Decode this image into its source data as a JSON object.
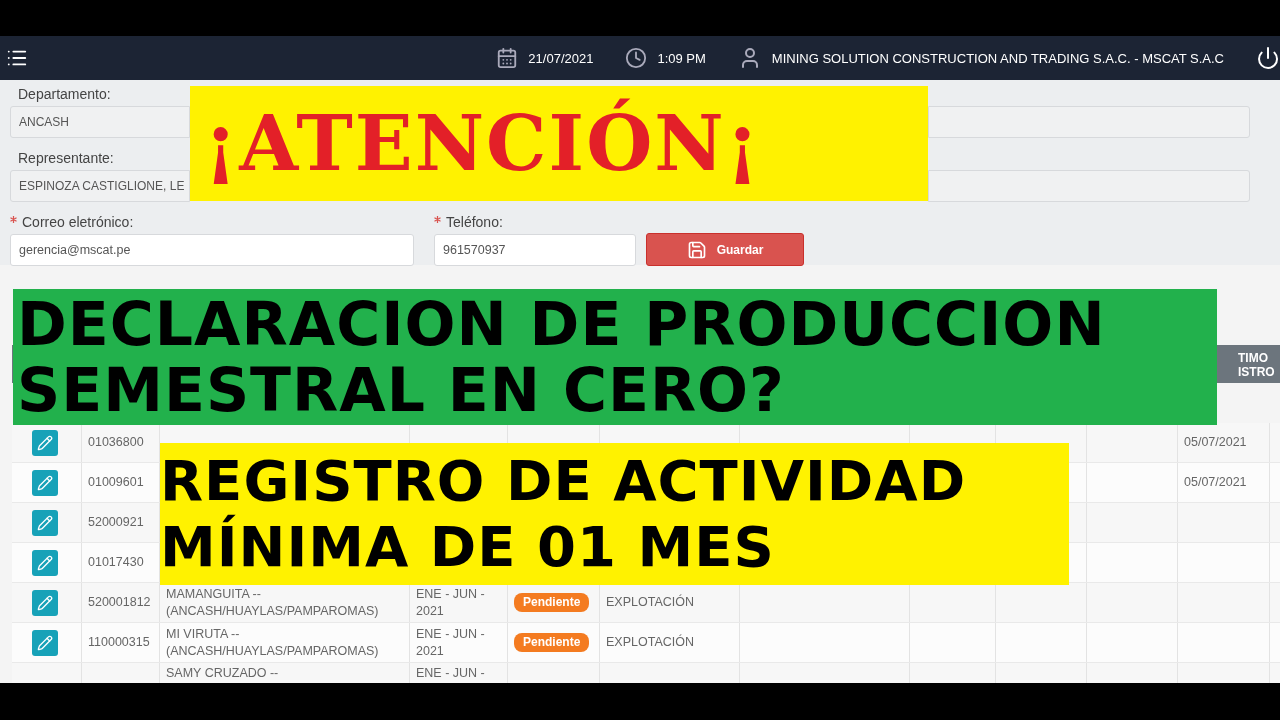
{
  "topbar": {
    "date": "21/07/2021",
    "time": "1:09 PM",
    "company": "MINING SOLUTION CONSTRUCTION AND TRADING S.A.C. - MSCAT S.A.C"
  },
  "form": {
    "wide_fields": [
      {
        "label": "Departamento:",
        "value": "ANCASH"
      },
      {
        "label": "Representante:",
        "value": "ESPINOZA CASTIGLIONE, LE"
      }
    ],
    "fields": [
      {
        "label": "Correo eletrónico:",
        "required": true,
        "value": "gerencia@mscat.pe"
      },
      {
        "label": "Teléfono:",
        "required": true,
        "value": "961570937"
      }
    ],
    "button": "Guardar"
  },
  "table": {
    "last_header": "TIMO ISTRO",
    "rows": [
      {
        "id": "01036800",
        "date": "05/07/2021"
      },
      {
        "id": "01009601",
        "date": "05/07/2021"
      },
      {
        "id": "52000921"
      },
      {
        "id": "01017430"
      },
      {
        "id": "520001812",
        "name": "MAMANGUITA -- (ANCASH/HUAYLAS/PAMPAROMAS)",
        "period": "ENE - JUN - 2021",
        "status": {
          "text": "Pendiente",
          "kind": "pending"
        },
        "activity": "EXPLOTACIÓN"
      },
      {
        "id": "110000315",
        "name": "MI VIRUTA -- (ANCASH/HUAYLAS/PAMPAROMAS)",
        "period": "ENE - JUN - 2021",
        "status": {
          "text": "Pendiente",
          "kind": "pending"
        },
        "activity": "EXPLOTACIÓN"
      },
      {
        "name": "SAMY CRUZADO --",
        "period": "ENE - JUN -"
      }
    ]
  },
  "banners": [
    {
      "kind": "attention",
      "lines": [
        "¡ATENCIÓN¡"
      ]
    },
    {
      "kind": "green",
      "lines": [
        "DECLARACION DE PRODUCCION",
        "SEMESTRAL EN CERO?"
      ]
    },
    {
      "kind": "yellow",
      "lines": [
        "REGISTRO DE ACTIVIDAD",
        "MÍNIMA DE 01 MES"
      ]
    }
  ]
}
